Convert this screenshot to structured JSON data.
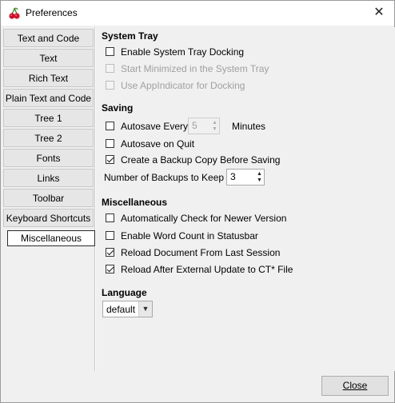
{
  "window": {
    "title": "Preferences",
    "close_glyph": "✕",
    "app_icon": "cherry-icon"
  },
  "sidebar": {
    "items": [
      {
        "label": "Text and Code",
        "active": false
      },
      {
        "label": "Text",
        "active": false
      },
      {
        "label": "Rich Text",
        "active": false
      },
      {
        "label": "Plain Text and Code",
        "active": false
      },
      {
        "label": "Tree 1",
        "active": false
      },
      {
        "label": "Tree 2",
        "active": false
      },
      {
        "label": "Fonts",
        "active": false
      },
      {
        "label": "Links",
        "active": false
      },
      {
        "label": "Toolbar",
        "active": false
      },
      {
        "label": "Keyboard Shortcuts",
        "active": false
      },
      {
        "label": "Miscellaneous",
        "active": true
      }
    ]
  },
  "system_tray": {
    "title": "System Tray",
    "enable_docking": {
      "label": "Enable System Tray Docking",
      "checked": false,
      "enabled": true
    },
    "start_minimized": {
      "label": "Start Minimized in the System Tray",
      "checked": false,
      "enabled": false
    },
    "use_appindicator": {
      "label": "Use AppIndicator for Docking",
      "checked": false,
      "enabled": false
    }
  },
  "saving": {
    "title": "Saving",
    "autosave_every": {
      "label": "Autosave Every",
      "checked": false,
      "value": "5",
      "suffix": "Minutes",
      "enabled": false
    },
    "autosave_on_quit": {
      "label": "Autosave on Quit",
      "checked": false
    },
    "backup_copy": {
      "label": "Create a Backup Copy Before Saving",
      "checked": true
    },
    "num_backups": {
      "label": "Number of Backups to Keep",
      "value": "3"
    }
  },
  "miscellaneous": {
    "title": "Miscellaneous",
    "check_newer": {
      "label": "Automatically Check for Newer Version",
      "checked": false
    },
    "word_count": {
      "label": "Enable Word Count in Statusbar",
      "checked": false
    },
    "reload_last_session": {
      "label": "Reload Document From Last Session",
      "checked": true
    },
    "reload_external": {
      "label": "Reload After External Update to CT* File",
      "checked": true
    }
  },
  "language": {
    "title": "Language",
    "selected": "default"
  },
  "footer": {
    "close_label": "Close"
  }
}
